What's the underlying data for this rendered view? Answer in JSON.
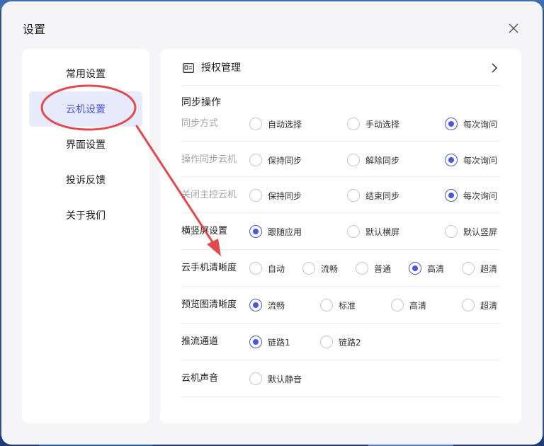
{
  "dialog": {
    "title": "设置"
  },
  "sidebar": {
    "items": [
      {
        "label": "常用设置",
        "active": false
      },
      {
        "label": "云机设置",
        "active": true
      },
      {
        "label": "界面设置",
        "active": false
      },
      {
        "label": "投诉反馈",
        "active": false
      },
      {
        "label": "关于我们",
        "active": false
      }
    ]
  },
  "content": {
    "auth": {
      "label": "授权管理"
    },
    "sync_section_title": "同步操作",
    "rows": [
      {
        "label": "同步方式",
        "muted": true,
        "options": [
          {
            "label": "自动选择",
            "checked": false
          },
          {
            "label": "手动选择",
            "checked": false
          },
          {
            "label": "每次询问",
            "checked": true
          }
        ]
      },
      {
        "label": "操作同步云机",
        "muted": true,
        "options": [
          {
            "label": "保持同步",
            "checked": false
          },
          {
            "label": "解除同步",
            "checked": false
          },
          {
            "label": "每次询问",
            "checked": true
          }
        ]
      },
      {
        "label": "关闭主控云机",
        "muted": true,
        "options": [
          {
            "label": "保持同步",
            "checked": false
          },
          {
            "label": "结束同步",
            "checked": false
          },
          {
            "label": "每次询问",
            "checked": true
          }
        ]
      },
      {
        "label": "横竖屏设置",
        "muted": false,
        "options": [
          {
            "label": "跟随应用",
            "checked": true
          },
          {
            "label": "默认横屏",
            "checked": false
          },
          {
            "label": "默认竖屏",
            "checked": false
          }
        ]
      },
      {
        "label": "云手机清晰度",
        "muted": false,
        "options": [
          {
            "label": "自动",
            "checked": false
          },
          {
            "label": "流畅",
            "checked": false
          },
          {
            "label": "普通",
            "checked": false
          },
          {
            "label": "高清",
            "checked": true
          },
          {
            "label": "超清",
            "checked": false
          }
        ]
      },
      {
        "label": "预览图清晰度",
        "muted": false,
        "options": [
          {
            "label": "流畅",
            "checked": true
          },
          {
            "label": "标准",
            "checked": false
          },
          {
            "label": "高清",
            "checked": false
          },
          {
            "label": "超清",
            "checked": false
          }
        ]
      },
      {
        "label": "推流通道",
        "muted": false,
        "options": [
          {
            "label": "链路1",
            "checked": true
          },
          {
            "label": "链路2",
            "checked": false
          }
        ]
      },
      {
        "label": "云机声音",
        "muted": false,
        "options": [
          {
            "label": "默认静音",
            "checked": false
          }
        ]
      }
    ]
  },
  "colors": {
    "accent": "#4a57d8",
    "annotation": "#e2484c",
    "active_bg": "#e8ebfb"
  },
  "icons": {
    "close": "close-icon",
    "auth": "license-card-icon",
    "chevron": "chevron-right-icon"
  }
}
